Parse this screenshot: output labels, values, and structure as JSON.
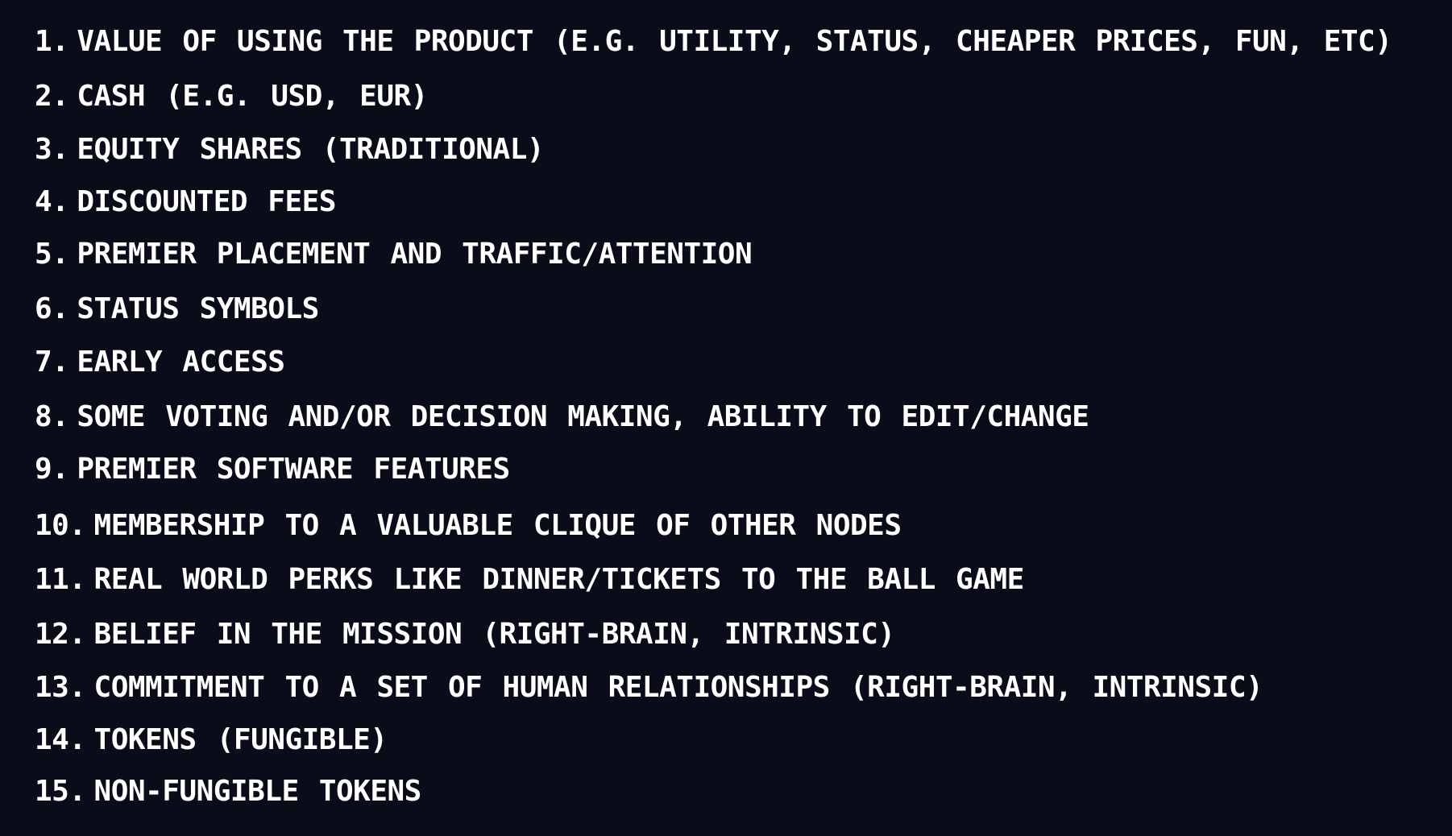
{
  "background_color": "#0b0c1a",
  "text_color": "#ffffff",
  "items": [
    {
      "number": "1.",
      "text": "VALUE OF USING THE PRODUCT (E.G. UTILITY, STATUS, CHEAPER PRICES, FUN, ETC)"
    },
    {
      "number": "2.",
      "text": "CASH (E.G. USD, EUR)"
    },
    {
      "number": "3.",
      "text": "EQUITY SHARES (TRADITIONAL)"
    },
    {
      "number": "4.",
      "text": "DISCOUNTED FEES"
    },
    {
      "number": "5.",
      "text": "PREMIER PLACEMENT AND TRAFFIC/ATTENTION"
    },
    {
      "number": "6.",
      "text": "STATUS SYMBOLS"
    },
    {
      "number": "7.",
      "text": "EARLY ACCESS"
    },
    {
      "number": "8.",
      "text": "SOME VOTING AND/OR DECISION MAKING, ABILITY TO EDIT/CHANGE"
    },
    {
      "number": "9.",
      "text": "PREMIER SOFTWARE FEATURES"
    },
    {
      "number": "10.",
      "text": "MEMBERSHIP TO A VALUABLE CLIQUE OF OTHER NODES"
    },
    {
      "number": "11.",
      "text": "REAL WORLD PERKS LIKE DINNER/TICKETS TO THE BALL GAME"
    },
    {
      "number": "12.",
      "text": "BELIEF IN THE MISSION (RIGHT-BRAIN, INTRINSIC)"
    },
    {
      "number": "13.",
      "text": "COMMITMENT TO A SET OF HUMAN RELATIONSHIPS (RIGHT-BRAIN, INTRINSIC)"
    },
    {
      "number": "14.",
      "text": "TOKENS (FUNGIBLE)"
    },
    {
      "number": "15.",
      "text": "NON-FUNGIBLE TOKENS"
    }
  ]
}
